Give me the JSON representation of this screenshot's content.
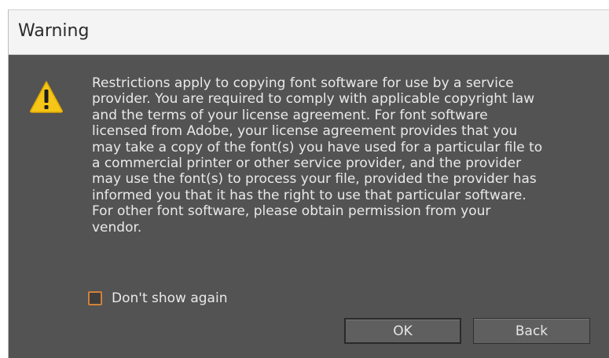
{
  "window": {
    "title": "Warning"
  },
  "icon": {
    "name": "warning-icon",
    "color": "#f5c518"
  },
  "message": "Restrictions apply to copying font software for use by a service provider.  You are required to comply with applicable copyright law and the terms of your license agreement.  For font software licensed from Adobe, your license agreement provides that you may take a copy of the font(s) you have used for a particular file to a commercial printer or other service provider, and the provider may use the font(s) to process your file, provided the provider has informed you that it has the right to use that particular software. For other font software, please obtain permission from your vendor.",
  "message_lines": [
    "Restrictions apply to copying font software for use by a service",
    "provider.  You are required to comply with applicable copyright law",
    "and the terms of your license agreement.  For font software",
    "licensed from Adobe, your license agreement provides that you",
    "may take a copy of the font(s) you have used for a particular file to",
    "a commercial printer or other service provider, and the provider",
    "may use the font(s) to process your file, provided the provider has",
    "informed you that it has the right to use that particular software.",
    "For other font software, please obtain permission from your",
    "vendor."
  ],
  "checkbox": {
    "label": "Don't show again",
    "checked": false,
    "accent_color": "#d1813a"
  },
  "buttons": {
    "ok_label": "OK",
    "back_label": "Back"
  }
}
